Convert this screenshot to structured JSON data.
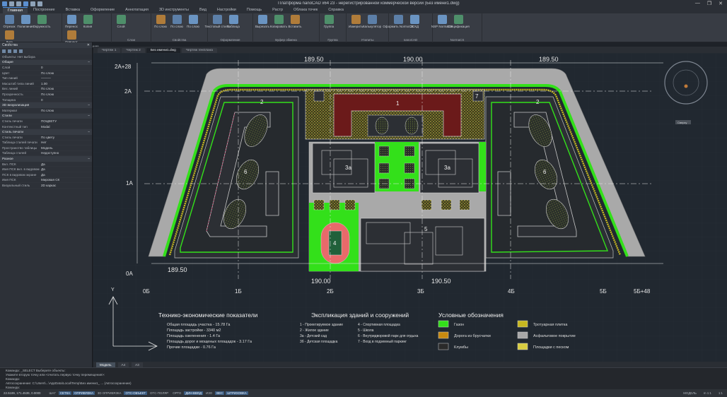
{
  "window": {
    "title": "Платформа nanoCAD x64 23 - нерегистрированной коммерческой версии (Без имени1.dwg)",
    "controls": [
      "—",
      "❐",
      "✕"
    ]
  },
  "ribbon_tabs": [
    "Главная",
    "Построение",
    "Вставка",
    "Оформление",
    "Аннотатация",
    "3D инструменты",
    "Вид",
    "Настройки",
    "Помощь",
    "Растр",
    "Облака точек",
    "Справка"
  ],
  "ribbon_groups": [
    {
      "label": "Черчение",
      "tools": [
        "Отрезок",
        "Полилиния",
        "Окружность",
        "Дуга"
      ]
    },
    {
      "label": "Редактирование",
      "tools": [
        "Перенос",
        "Копия",
        "Поворот"
      ]
    },
    {
      "label": "Слои",
      "tools": [
        "Слой"
      ]
    },
    {
      "label": "Свойства",
      "tools": [
        "По слою",
        "По слою",
        "По слою"
      ]
    },
    {
      "label": "Оформление",
      "tools": [
        "Текстовый стиль",
        "Таблица"
      ]
    },
    {
      "label": "Буфер обмена",
      "tools": [
        "Вырезать",
        "Копировать",
        "Вставить"
      ]
    },
    {
      "label": "Группа",
      "tools": [
        "Группа"
      ]
    },
    {
      "label": "Утилиты",
      "tools": [
        "Измерить",
        "Калькулятор"
      ]
    },
    {
      "label": "nanoCAD",
      "tools": [
        "Оформить NormoCS",
        "ЭСКД"
      ]
    },
    {
      "label": "NormaCS",
      "tools": [
        "NSP NormaCS",
        "Спецификация"
      ]
    }
  ],
  "props_panel": {
    "title": "Свойства",
    "object": "Объекты: Нет выбора",
    "sections": [
      {
        "name": "Общие",
        "rows": [
          [
            "Слой",
            "0"
          ],
          [
            "Цвет",
            "По слою"
          ],
          [
            "Тип линий",
            "———"
          ],
          [
            "Масштаб типа линий",
            "1.00"
          ],
          [
            "Вес линий",
            "По слою"
          ],
          [
            "Прозрачность",
            "По слою"
          ],
          [
            "Толщина",
            "0"
          ]
        ]
      },
      {
        "name": "3D визуализация",
        "rows": [
          [
            "Материал",
            "По слою"
          ]
        ]
      },
      {
        "name": "Стили",
        "rows": [
          [
            "Стиль печати",
            "ПОЦВЕТУ"
          ],
          [
            "Контекстный тип",
            "Modal"
          ]
        ]
      },
      {
        "name": "Стиль печати",
        "rows": [
          [
            "Стиль печати",
            "По цвету"
          ],
          [
            "Таблица стилей печати",
            "Нет"
          ],
          [
            "Пространство таблицы",
            "Модель"
          ],
          [
            "Таблица стилей",
            "Недоступно"
          ]
        ]
      },
      {
        "name": "Разное",
        "rows": [
          [
            "Вкл. ПСК",
            "Да"
          ],
          [
            "Имя ПСК вкл. в видовом",
            "Да"
          ],
          [
            "ПСК в видовом экране",
            "Да"
          ],
          [
            "Имя ПСК",
            "Мировая СК"
          ],
          [
            "Визуальный стиль",
            "2D каркас"
          ]
        ]
      }
    ]
  },
  "doc_tabs": [
    "Чертеж 1",
    "Чертеж 2",
    "Без имени1.dwg",
    "Чертеж генплана"
  ],
  "active_doc_tab": 2,
  "drawing": {
    "dims": [
      "189.50",
      "190.00",
      "189.50",
      "189.50",
      "190.00",
      "190.50"
    ],
    "axis_h": [
      "2А+28",
      "2А",
      "1А",
      "0А"
    ],
    "axis_v": [
      "0Б",
      "1Б",
      "2Б",
      "3Б",
      "4Б",
      "5Б",
      "5Б+48"
    ],
    "buildings": {
      "b1": "1",
      "b2l": "2",
      "b2r": "2",
      "b3a1": "3а",
      "b3a2": "3а",
      "b5": "5",
      "b6l": "6",
      "b6r": "6",
      "b4": "4",
      "b7": "7",
      "b3b": "3б"
    },
    "tep": {
      "title": "Технико-экономические показатели",
      "lines": [
        "Общая площадь участка - 15.78 Га",
        "Площадь застройки - 3340 м2",
        "Площадь озеленения - 1.4 Га",
        "Площадь дорог и мощеных площадок - 3.17 Га",
        "Прочие площадки - 0.76 Га"
      ]
    },
    "explication": {
      "title": "Экспликация зданий и сооружений",
      "col1": [
        "1 - Проектируемое здание",
        "2 - Жилое здание",
        "3а - Детский сад",
        "3б - Детская площадка"
      ],
      "col2": [
        "4 - Спортивная площадка",
        "5 - Школа",
        "6 - Внутридворовой парк для отдыха",
        "7 - Вход в подземный паркинг"
      ]
    },
    "legend": {
      "title": "Условные обозначения",
      "items": [
        {
          "label": "Газон",
          "color": "#33e01a"
        },
        {
          "label": "Тротуарная плитка",
          "color": "#c8b820"
        },
        {
          "label": "Дорога из брусчатки",
          "color": "#c88a10"
        },
        {
          "label": "Асфальтовое покрытие",
          "color": "#a8a8a8"
        },
        {
          "label": "Клумбы",
          "color": "#2a2a2a"
        },
        {
          "label": "Площадки с песком",
          "color": "#d8cc40"
        }
      ]
    },
    "nav_label": "Сверху",
    "ucs_y": "Y"
  },
  "layout_tabs": [
    "Модель",
    "A4",
    "A3"
  ],
  "cmd_lines": [
    "Команда: _SELECT Выберите объекты:",
    "Укажите вторую точку или <считать первую точку перемещения>:",
    "Команда:",
    "Автосохранение: C:\\Users\\...\\AppData\\Local\\Temp\\Без имени1_ ... (Автосохранение)",
    "Команда:"
  ],
  "status": {
    "coords": "22.5189, 171.4539, 0.0000",
    "buttons": [
      {
        "t": "ШАГ",
        "on": false
      },
      {
        "t": "СЕТКА",
        "on": true
      },
      {
        "t": "ОПРИВЯЗКА",
        "on": true
      },
      {
        "t": "3D ОПРИВЯЗКА",
        "on": false
      },
      {
        "t": "ОТС-ОБЪЕКТ",
        "on": true
      },
      {
        "t": "ОТС-ПОЛЯР",
        "on": false
      },
      {
        "t": "ОРТО",
        "on": false
      },
      {
        "t": "ДИН-ВВОД",
        "on": true
      },
      {
        "t": "ИЗО",
        "on": false
      },
      {
        "t": "ВЕС",
        "on": true
      },
      {
        "t": "ШТРИХОВКА",
        "on": true
      }
    ],
    "right": [
      "МОДЕЛЬ",
      "m 1:1",
      "1:1"
    ]
  }
}
